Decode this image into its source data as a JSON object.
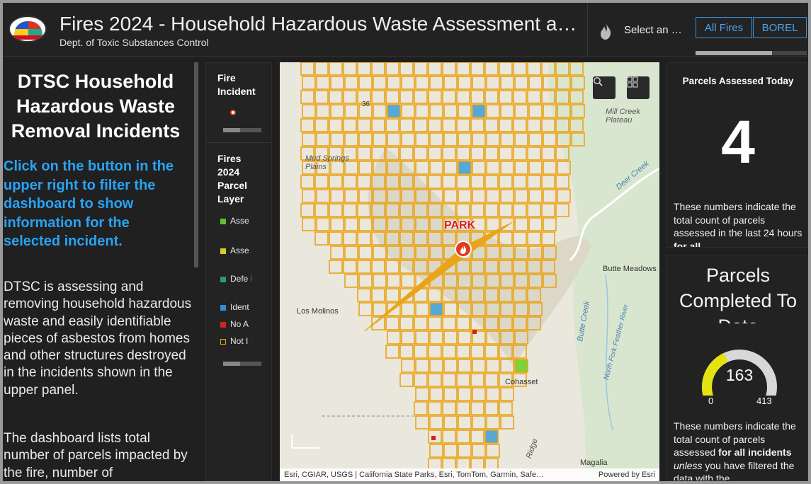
{
  "header": {
    "title": "Fires 2024 - Household Hazardous Waste Assessment a…",
    "subtitle": "Dept. of Toxic Substances Control",
    "select_label": "Select an …",
    "buttons": [
      "All Fires",
      "BOREL"
    ]
  },
  "left_panel": {
    "heading": "DTSC Household Hazardous Waste Removal Incidents",
    "cta": "Click on the button in the upper right to filter the dashboard to show information for the selected incident.",
    "para1": "DTSC is assessing and removing household hazardous waste and easily identifiable pieces of asbestos from homes and other structures destroyed in the incidents shown in the upper panel.",
    "para2": "The dashboard lists total number of parcels impacted by the fire, number of"
  },
  "legend": {
    "incident_title": "Fire Incident",
    "parcel_title": "Fires 2024 Parcel Layer",
    "items": [
      {
        "label": "Asse Com",
        "color": "#5cc22e"
      },
      {
        "label": "Asse Retur",
        "color": "#d8d020"
      },
      {
        "label": "Defe Phas",
        "color": "#2a9a7a"
      },
      {
        "label": "Ident",
        "color": "#2f8fd8"
      },
      {
        "label": "No A",
        "color": "#d82020"
      },
      {
        "label": "Not I",
        "color": "#e8a020"
      }
    ]
  },
  "map": {
    "incident_label": "PARK",
    "places": {
      "mill_creek": "Mill Creek Plateau",
      "mud_springs": "Mud Springs Plains",
      "butte_meadows": "Butte Meadows",
      "los_molinos": "Los Molinos",
      "magalia": "Magalia",
      "cohasset": "Cohasset",
      "deer_creek": "Deer Creek",
      "butte_creek": "Butte Creek",
      "feather_river": "North Fork Feather River",
      "ridge": "Ridge",
      "route": "36"
    },
    "attribution": "Esri, CGIAR, USGS | California State Parks, Esri, TomTom, Garmin, Safe…",
    "powered_by": "Powered by Esri"
  },
  "parcels_today": {
    "title": "Parcels Assessed Today",
    "value": "4",
    "note_start": "These numbers indicate the total count of parcels assessed in the last 24 hours ",
    "note_bold": "for all"
  },
  "parcels_completed": {
    "title": "Parcels Completed To Date",
    "value": "163",
    "min": "0",
    "max": "413",
    "fraction": 0.395,
    "note_start": "These numbers indicate the total count of parcels assessed ",
    "note_bold": "for all incidents",
    "note_italic": "unless",
    "note_end": " you have filtered the data with the"
  }
}
